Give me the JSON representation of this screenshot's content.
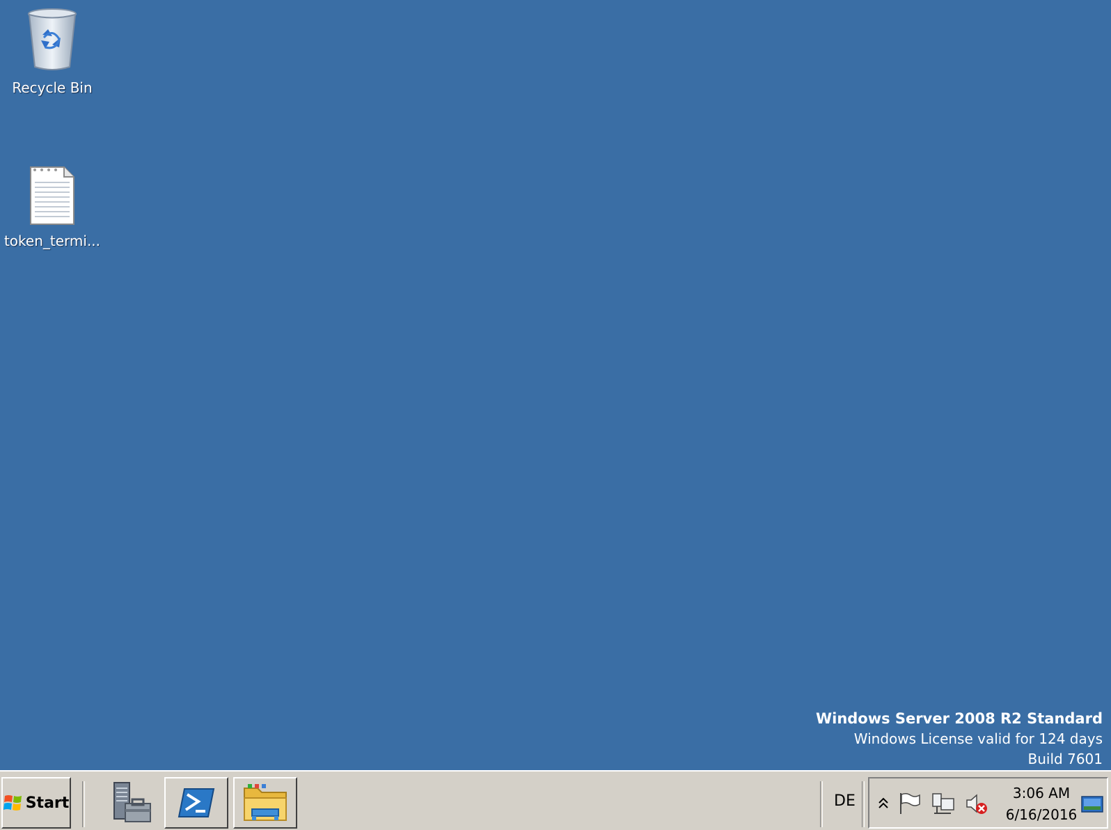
{
  "desktop": {
    "background_color": "#3a6ea5",
    "icons": [
      {
        "label": "Recycle Bin",
        "icon": "recycle-bin-icon"
      },
      {
        "label": "token_termi...",
        "icon": "text-file-icon"
      }
    ],
    "watermark": {
      "edition": "Windows Server 2008 R2 Standard",
      "license": "Windows License valid for 124 days",
      "build": "Build 7601"
    }
  },
  "taskbar": {
    "start_label": "Start",
    "pinned": [
      {
        "name": "Server Manager",
        "icon": "server-manager-icon"
      },
      {
        "name": "Windows PowerShell",
        "icon": "powershell-icon"
      },
      {
        "name": "Windows Explorer",
        "icon": "folder-icon"
      }
    ],
    "language": "DE",
    "tray_icons": [
      "show-hidden-icons-chevron",
      "action-center-flag-icon",
      "network-icon",
      "volume-muted-icon"
    ],
    "clock": {
      "time": "3:06 AM",
      "date": "6/16/2016"
    }
  }
}
